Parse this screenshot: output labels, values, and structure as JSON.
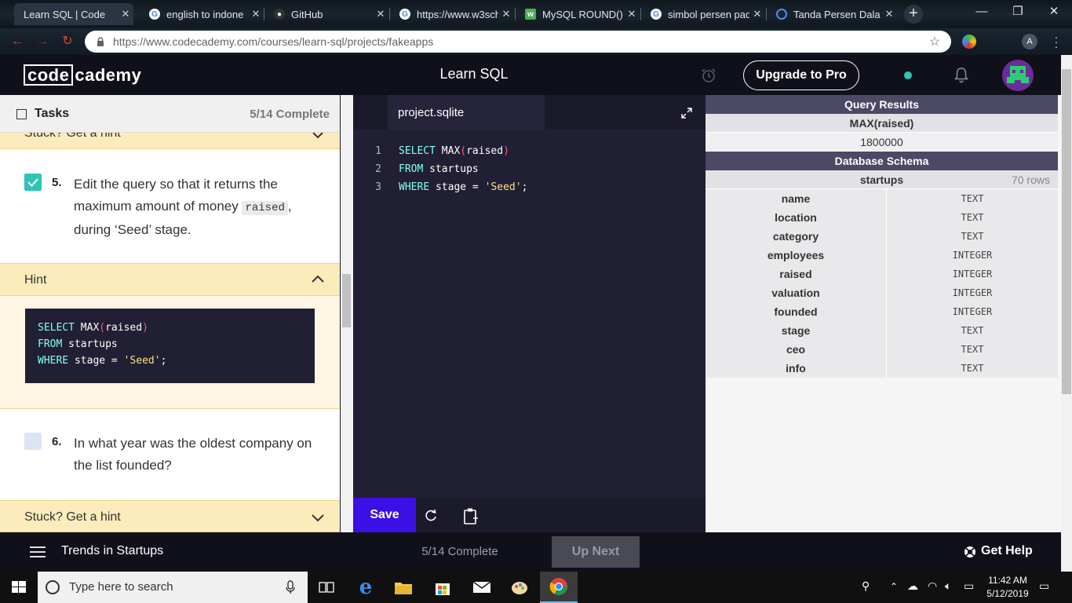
{
  "browser": {
    "tabs": [
      {
        "title": "Learn SQL | Code",
        "favicon": "codecademy-icon"
      },
      {
        "title": "english to indone",
        "favicon": "google-icon"
      },
      {
        "title": "GitHub",
        "favicon": "github-icon"
      },
      {
        "title": "https://www.w3sch",
        "favicon": "google-icon"
      },
      {
        "title": "MySQL ROUND()",
        "favicon": "w3schools-icon"
      },
      {
        "title": "simbol persen pad",
        "favicon": "google-icon"
      },
      {
        "title": "Tanda Persen Dala",
        "favicon": "loading-icon"
      }
    ],
    "url": "https://www.codecademy.com/courses/learn-sql/projects/fakeapps",
    "profile_initial": "A"
  },
  "header": {
    "logo_left": "code",
    "logo_right": "cademy",
    "course_title": "Learn SQL",
    "upgrade_label": "Upgrade to Pro"
  },
  "tasks": {
    "title": "Tasks",
    "progress": "5/14 Complete",
    "stuck_label": "Stuck? Get a hint",
    "hint_label": "Hint",
    "task5": {
      "number": "5.",
      "text_before": "Edit the query so that it returns the maximum amount of money ",
      "code": "raised",
      "text_after": ", during ‘Seed’ stage.",
      "checked": true
    },
    "hint_code": {
      "line1_kw": "SELECT",
      "line1_fn": "MAX",
      "line1_arg": "raised",
      "line2_kw": "FROM",
      "line2_rest": "startups",
      "line3_kw": "WHERE",
      "line3_rest": "stage = ",
      "line3_str": "'Seed'",
      "line3_end": ";"
    },
    "task6": {
      "number": "6.",
      "text": "In what year was the oldest company on the list founded?",
      "checked": false
    },
    "stuck_label_2": "Stuck? Get a hint"
  },
  "editor": {
    "filename": "project.sqlite",
    "line_numbers": [
      "1",
      "2",
      "3"
    ],
    "code": {
      "line1_kw": "SELECT",
      "line1_fn": "MAX",
      "line1_arg": "raised",
      "line2_kw": "FROM",
      "line2_rest": "startups",
      "line3_kw": "WHERE",
      "line3_rest": "stage = ",
      "line3_str": "'Seed'",
      "line3_end": ";"
    },
    "save_label": "Save"
  },
  "results": {
    "query_title": "Query Results",
    "column": "MAX(raised)",
    "value": "1800000",
    "schema_title": "Database Schema",
    "table_name": "startups",
    "row_count": "70 rows",
    "columns": [
      {
        "name": "name",
        "type": "TEXT"
      },
      {
        "name": "location",
        "type": "TEXT"
      },
      {
        "name": "category",
        "type": "TEXT"
      },
      {
        "name": "employees",
        "type": "INTEGER"
      },
      {
        "name": "raised",
        "type": "INTEGER"
      },
      {
        "name": "valuation",
        "type": "INTEGER"
      },
      {
        "name": "founded",
        "type": "INTEGER"
      },
      {
        "name": "stage",
        "type": "TEXT"
      },
      {
        "name": "ceo",
        "type": "TEXT"
      },
      {
        "name": "info",
        "type": "TEXT"
      }
    ]
  },
  "footer": {
    "course_name": "Trends in Startups",
    "progress": "5/14 Complete",
    "up_next_label": "Up Next",
    "help_label": "Get Help"
  },
  "taskbar": {
    "search_placeholder": "Type here to search",
    "time": "11:42 AM",
    "date": "5/12/2019"
  },
  "colors": {
    "accent": "#3a10e5",
    "hint_bg": "#fdecbb",
    "editor_bg": "#211f33",
    "header_bg": "#10101a",
    "results_header": "#4b4964",
    "status_dot": "#2ec4b6"
  }
}
